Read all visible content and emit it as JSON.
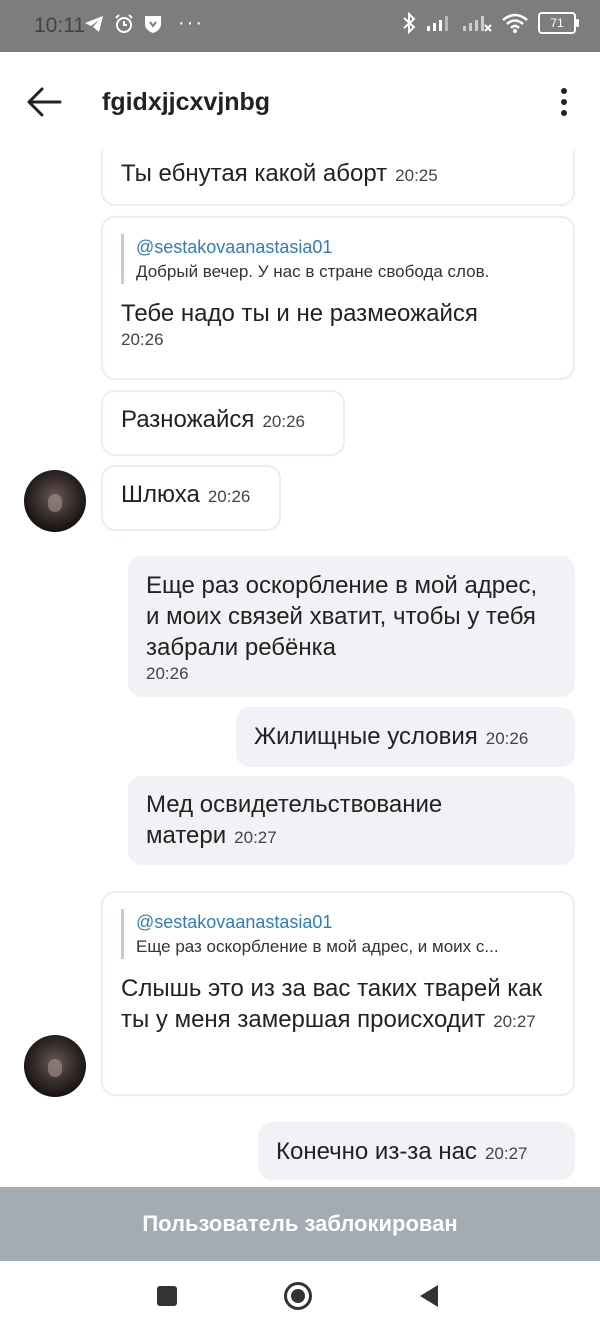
{
  "status_bar": {
    "time": "10:11",
    "dots": "···",
    "battery": "71",
    "icons": [
      "telegram-icon",
      "alarm-icon",
      "vk-shield-icon",
      "bluetooth-icon",
      "signal-icon",
      "signal-2-icon",
      "wifi-icon",
      "battery-icon"
    ]
  },
  "header": {
    "title": "fgidxjjcxvjnbg",
    "back_icon": "arrow-left-icon",
    "menu_icon": "more-vertical-icon"
  },
  "messages": [
    {
      "direction": "in",
      "text": "Ты ебнутая какой аборт",
      "time": "20:25"
    },
    {
      "direction": "in",
      "reply_author": "@sestakovaanastasia01",
      "reply_text": "Добрый вечер. У нас в стране свобода слов.",
      "text": "Тебе надо ты и не размеожайся",
      "time": "20:26"
    },
    {
      "direction": "in",
      "text": "Разножайся",
      "time": "20:26"
    },
    {
      "direction": "in",
      "text": "Шлюха",
      "time": "20:26"
    },
    {
      "direction": "out",
      "text": "Еще раз оскорбление в мой адрес, и моих связей хватит, чтобы у тебя забрали ребёнка",
      "time": "20:26"
    },
    {
      "direction": "out",
      "text": "Жилищные условия",
      "time": "20:26"
    },
    {
      "direction": "out",
      "text": "Мед освидетельствование матери",
      "time": "20:27"
    },
    {
      "direction": "in",
      "reply_author": "@sestakovaanastasia01",
      "reply_text": "Еще раз оскорбление в мой адрес, и моих с...",
      "text": "Слышь это из за вас таких тварей как ты у меня замершая происходит",
      "time": "20:27"
    },
    {
      "direction": "out",
      "text": "Конечно из-за нас",
      "time": "20:27"
    }
  ],
  "footer": {
    "blocked_label": "Пользователь заблокирован"
  },
  "nav_bar": {
    "icons": [
      "square-recents-icon",
      "circle-home-icon",
      "triangle-back-icon"
    ]
  },
  "colors": {
    "status_bar_bg": "#7d7d7d",
    "blocked_bar_bg": "#a3acb2",
    "reply_author": "#2f7dbb",
    "outgoing_bubble": "#f1f2f5"
  }
}
